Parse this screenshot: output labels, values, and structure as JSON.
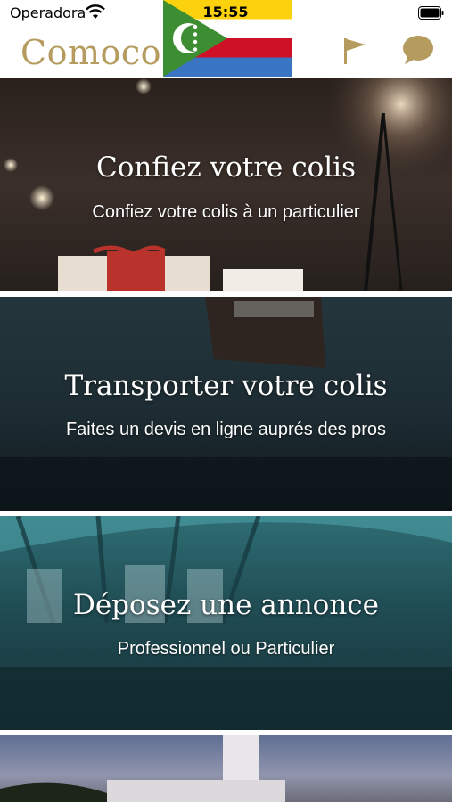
{
  "status_bar": {
    "carrier": "Operadora",
    "time": "15:55"
  },
  "header": {
    "brand": "Comoco",
    "icons": [
      "comoros-flag-icon",
      "flag-icon",
      "chat-bubble-icon"
    ]
  },
  "colors": {
    "brand_gold": "#b59b5e",
    "flag_yellow": "#fcd20f",
    "flag_white": "#ffffff",
    "flag_red": "#ce1126",
    "flag_blue": "#3a75c4",
    "flag_green": "#3d8e33"
  },
  "cards": [
    {
      "title": "Confiez votre colis",
      "subtitle": "Confiez votre colis à un particulier"
    },
    {
      "title": "Transporter votre colis",
      "subtitle": "Faites un devis en ligne auprés des pros"
    },
    {
      "title": "Déposez une annonce",
      "subtitle": "Professionnel ou Particulier"
    },
    {
      "title": "",
      "subtitle": ""
    }
  ]
}
